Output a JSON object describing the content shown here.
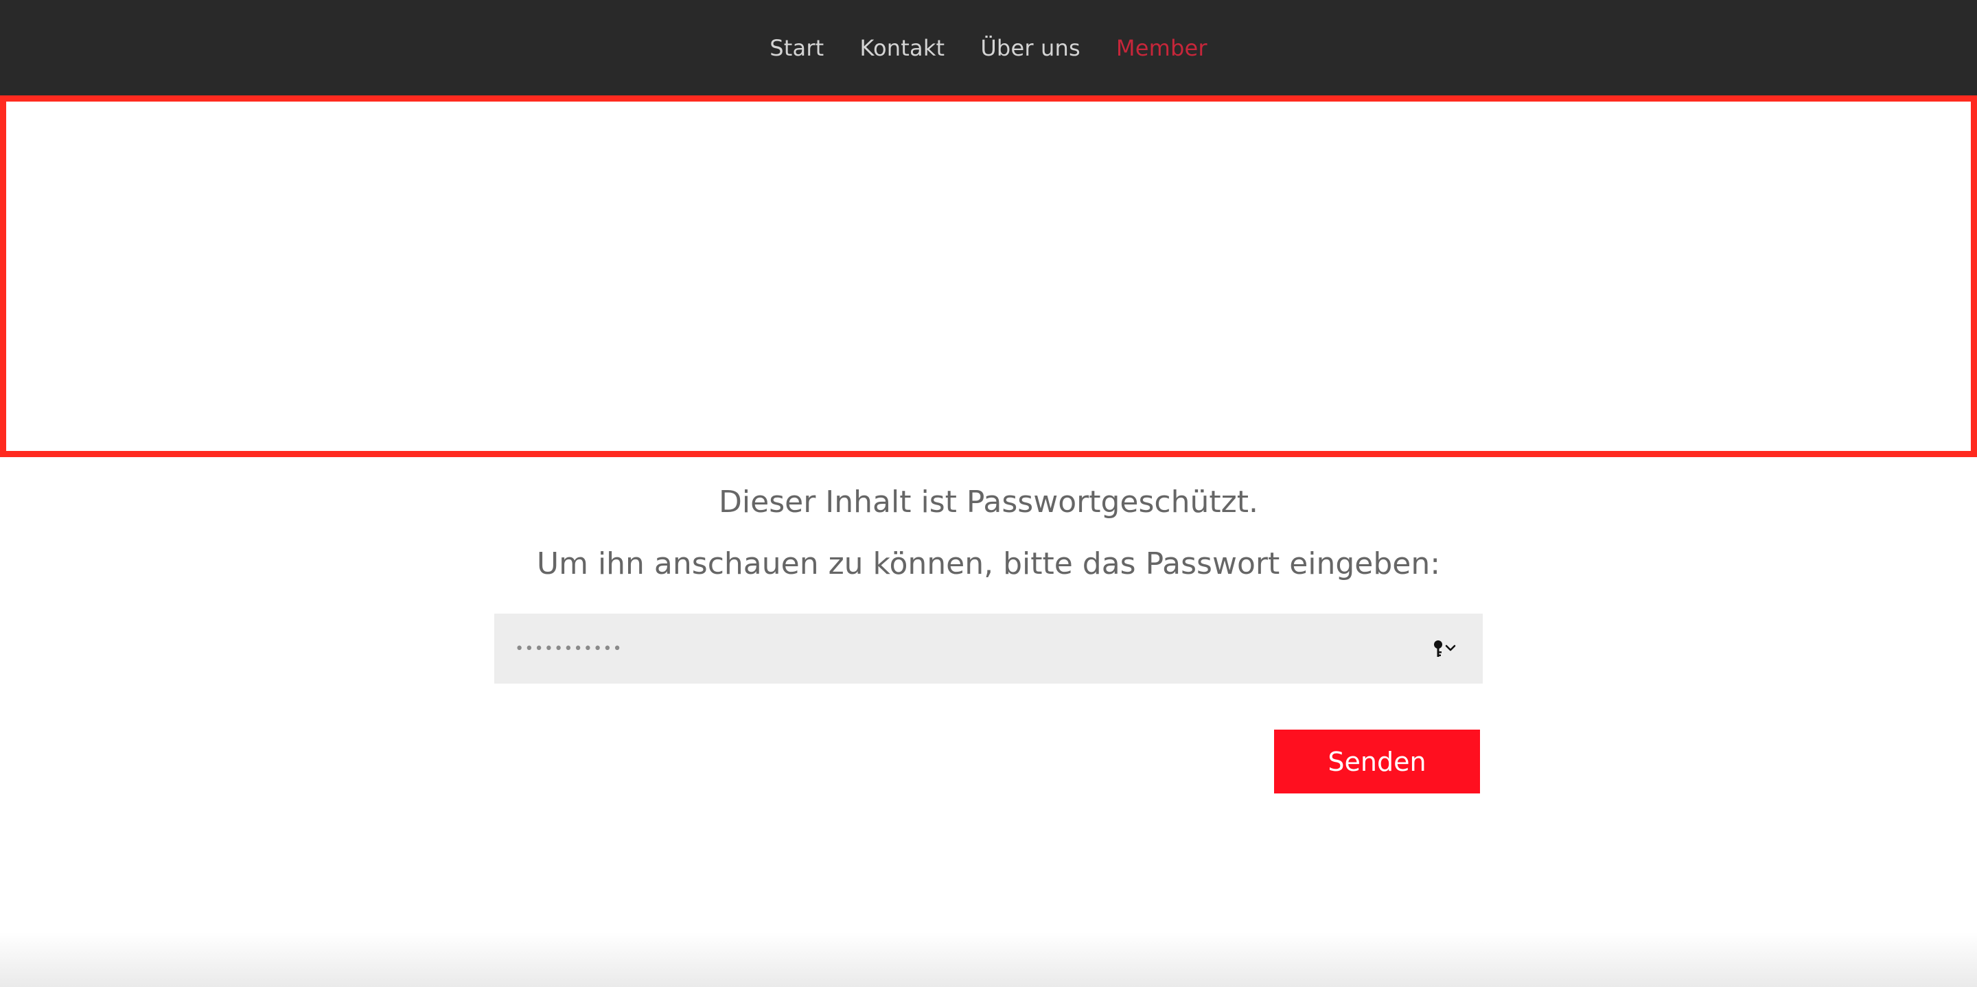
{
  "nav": {
    "items": [
      {
        "label": "Start"
      },
      {
        "label": "Kontakt"
      },
      {
        "label": "Über uns"
      },
      {
        "label": "Member"
      }
    ],
    "active_index": 3,
    "active_color": "#c6263a",
    "background_color": "#292929"
  },
  "highlight": {
    "border_color": "#ff2a1f"
  },
  "protected": {
    "message": "Dieser Inhalt ist Passwortgeschützt.",
    "prompt": "Um ihn anschauen zu können, bitte das Passwort eingeben:",
    "password_value": "•••••••••••",
    "password_manager_icon": "key-icon",
    "submit_label": "Senden",
    "submit_color": "#ff0f1f"
  }
}
